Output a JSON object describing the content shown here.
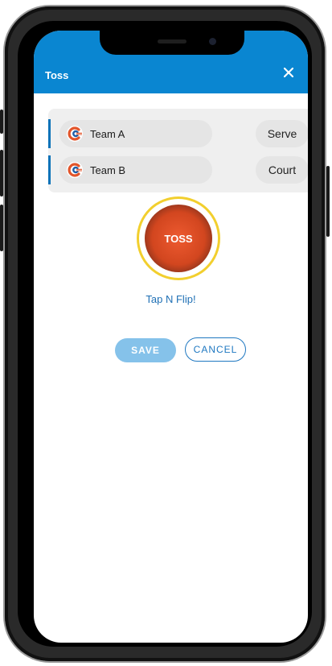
{
  "appbar": {
    "title": "Toss",
    "close_icon": "close-icon"
  },
  "teams": [
    {
      "name": "Team A",
      "option": "Serve",
      "logo_icon": "team-logo-icon"
    },
    {
      "name": "Team B",
      "option": "Court",
      "logo_icon": "team-logo-icon"
    }
  ],
  "toss": {
    "button_label": "TOSS",
    "hint": "Tap N Flip!"
  },
  "actions": {
    "save_label": "SAVE",
    "cancel_label": "CANCEL"
  },
  "colors": {
    "appbar": "#0a86d1",
    "accent": "#0a72b8",
    "toss_ring": "#f2cf2e",
    "toss_button": "#e1502a",
    "save_button": "#85c2ea"
  }
}
